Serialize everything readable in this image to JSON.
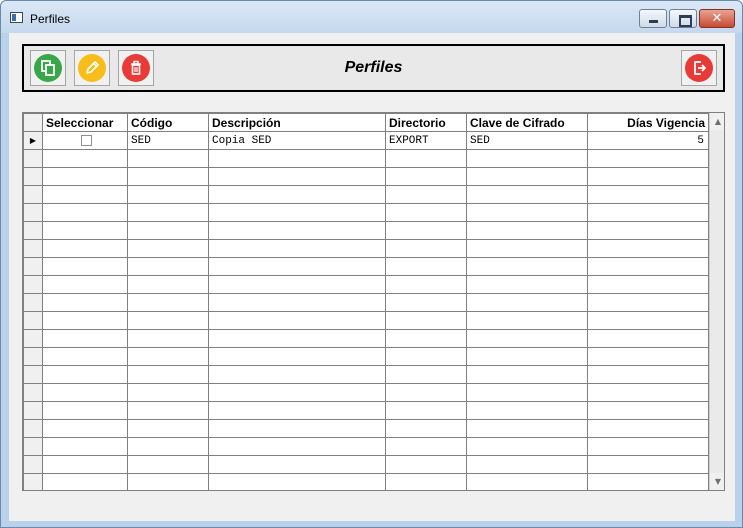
{
  "window": {
    "title": "Perfiles",
    "app_icon": "form-window-icon",
    "controls": {
      "minimize_icon": "minimize-icon",
      "maximize_icon": "maximize-icon",
      "close_label": "✕"
    }
  },
  "toolbar": {
    "title": "Perfiles",
    "buttons": [
      {
        "name": "copy",
        "icon": "copy-icon",
        "color": "#3aa64a"
      },
      {
        "name": "edit",
        "icon": "pencil-icon",
        "color": "#f6bd1b"
      },
      {
        "name": "delete",
        "icon": "trash-icon",
        "color": "#e83b37"
      },
      {
        "name": "exit",
        "icon": "exit-icon",
        "color": "#e83b37"
      }
    ]
  },
  "grid": {
    "columns": [
      "Seleccionar",
      "Código",
      "Descripción",
      "Directorio",
      "Clave de Cifrado",
      "Días Vigencia"
    ],
    "current_row_indicator": "▶",
    "rows": [
      {
        "seleccionar": false,
        "codigo": "SED",
        "descripcion": "Copia SED",
        "directorio": "EXPORT",
        "clave": "SED",
        "dias": "5"
      }
    ],
    "scroll_up": "▲",
    "scroll_down": "▼"
  }
}
